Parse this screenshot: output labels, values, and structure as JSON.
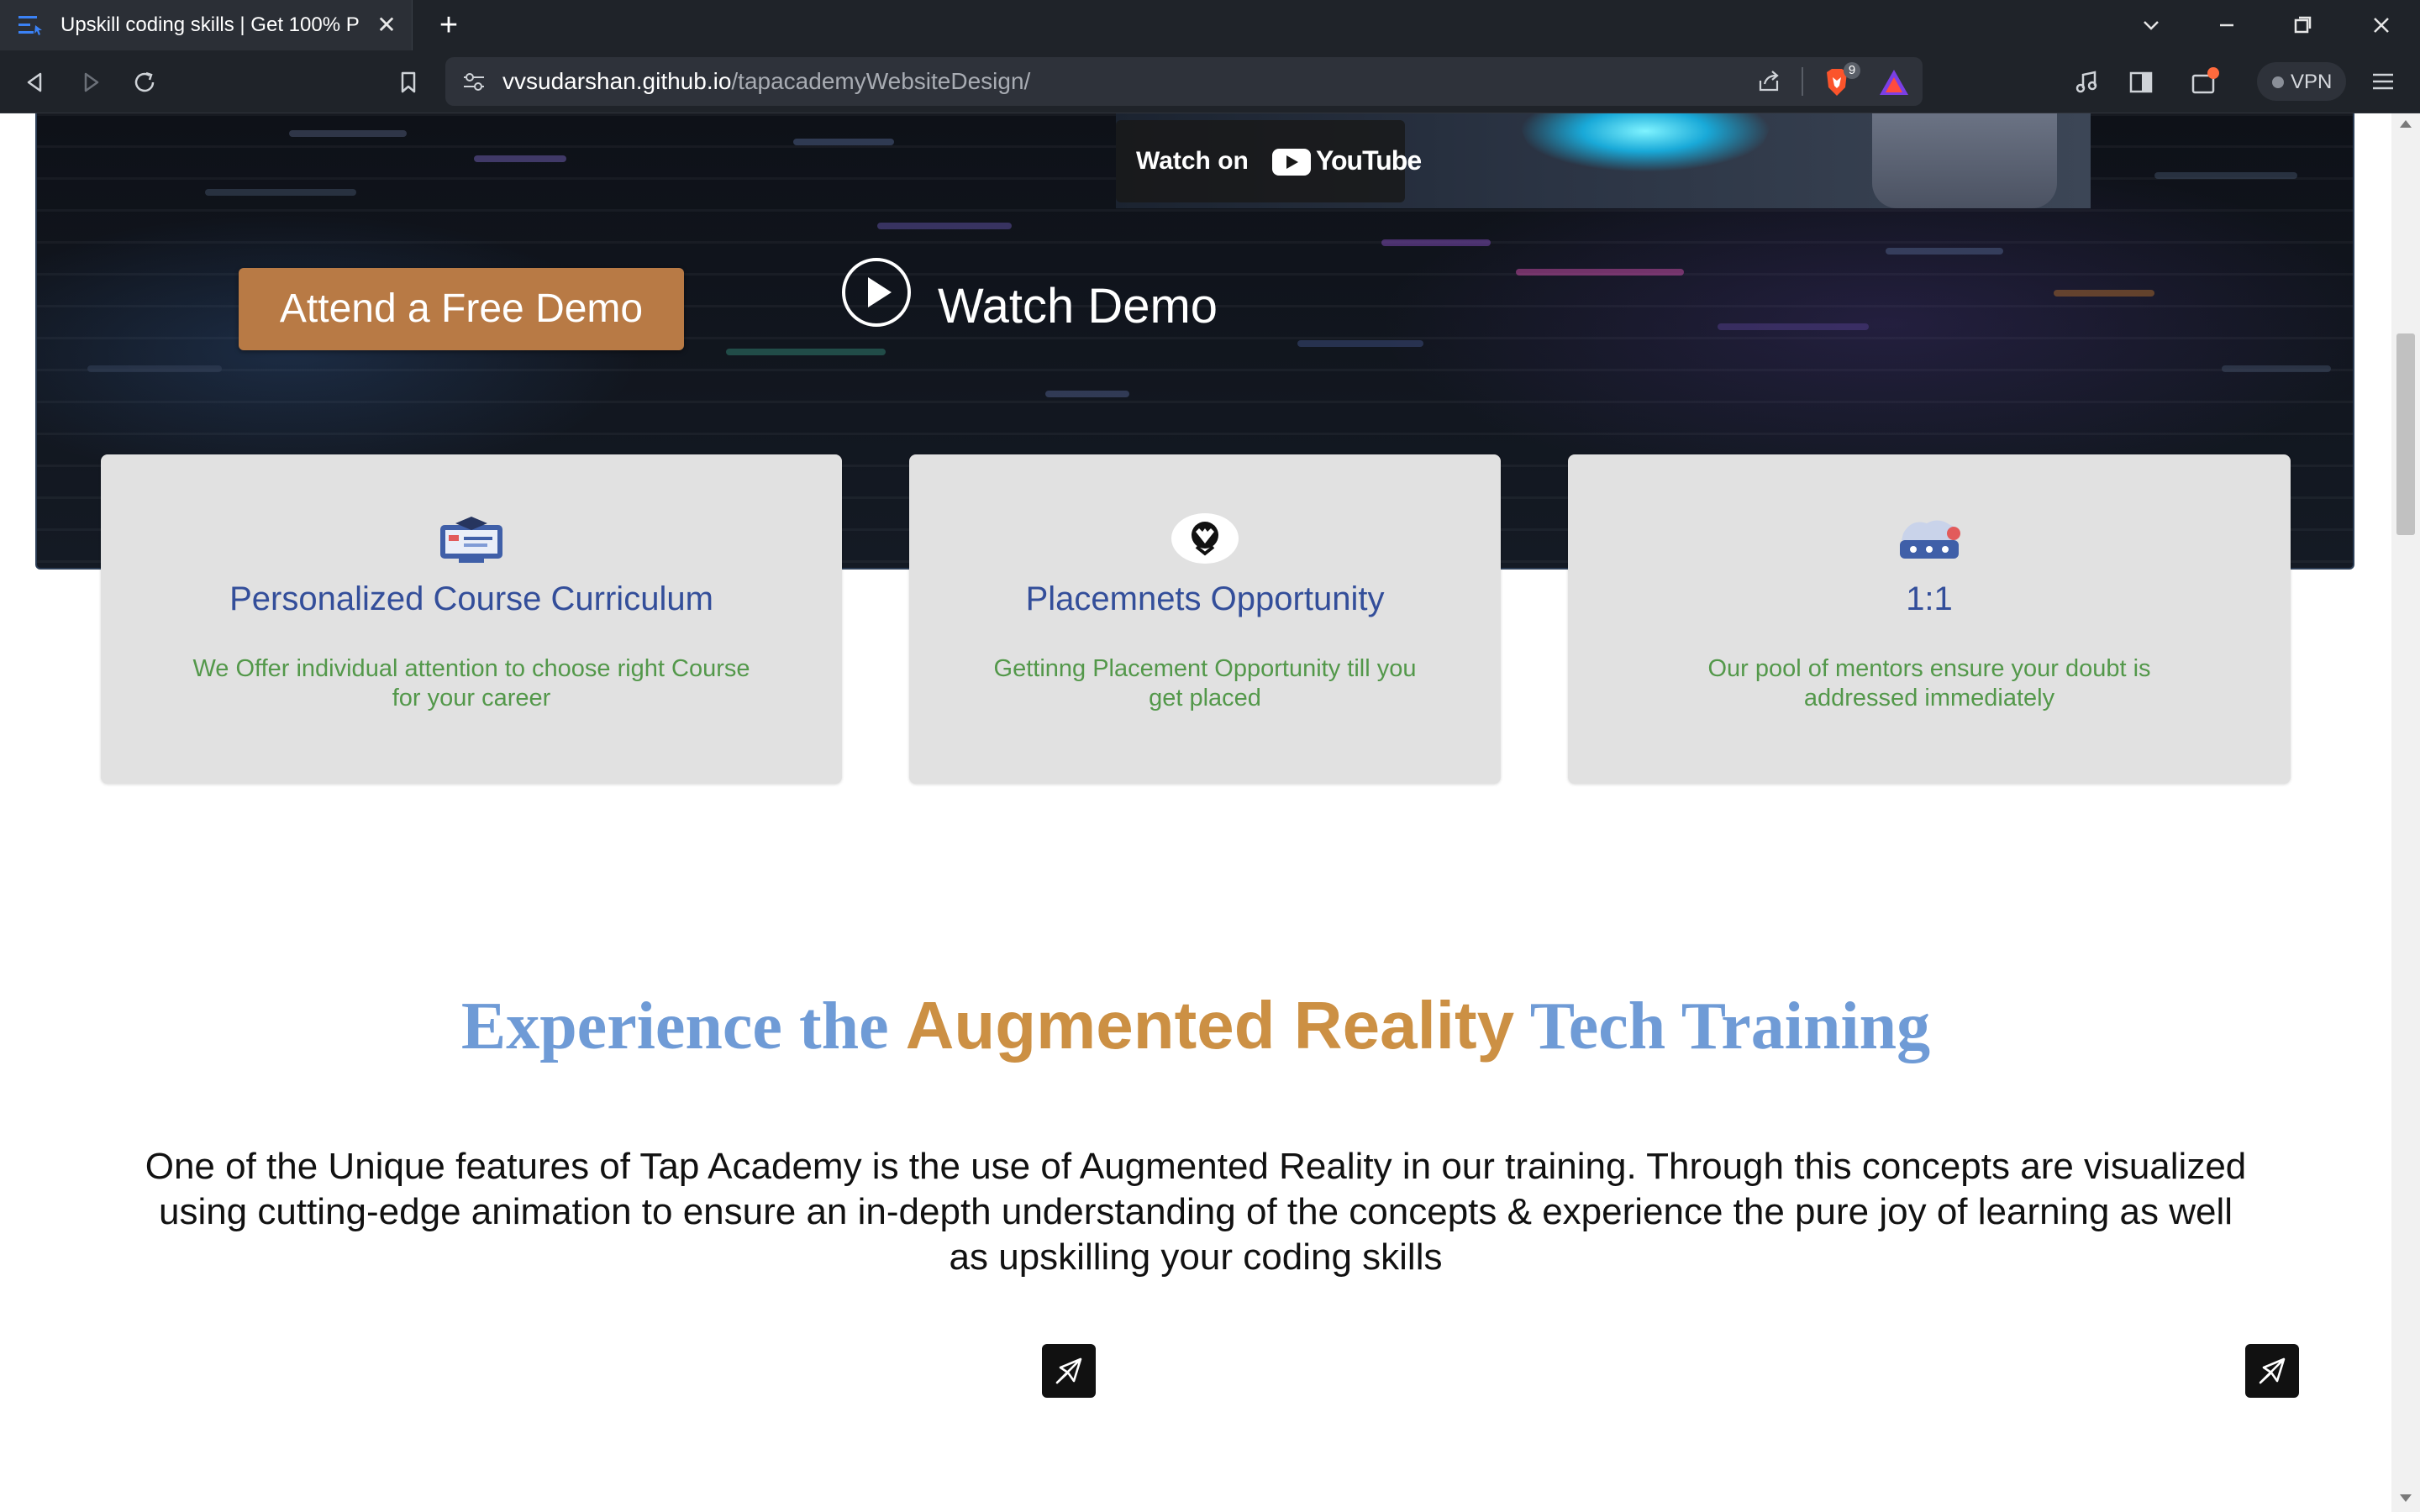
{
  "browser": {
    "tab_title": "Upskill coding skills | Get 100% P",
    "close_glyph": "✕",
    "new_tab_glyph": "+",
    "url_domain": "vvsudarshan.github.io",
    "url_path": "/tapacademyWebsiteDesign/",
    "shields_count": "9",
    "vpn_label": "VPN"
  },
  "hero": {
    "youtube_watch_label": "Watch on",
    "youtube_logo_text": "YouTube",
    "demo_button_label": "Attend a Free Demo",
    "watch_demo_label": "Watch Demo"
  },
  "features": [
    {
      "icon": "graduation-screen-icon",
      "title": "Personalized Course Curriculum",
      "description": "We Offer individual attention to choose right Course for your career"
    },
    {
      "icon": "placement-badge-icon",
      "title": "Placemnets Opportunity",
      "description": "Gettinng Placement Opportunity till you get placed"
    },
    {
      "icon": "mentor-chat-icon",
      "title": "1:1",
      "description": "Our pool of mentors ensure your doubt is addressed immediately"
    }
  ],
  "ar_section": {
    "heading_part1": "Experience the ",
    "heading_highlight": "Augmented Reality",
    "heading_part2": " Tech Training",
    "paragraph": "One of the Unique features of Tap Academy is the use of Augmented Reality in our training. Through this concepts are visualized using cutting-edge animation to ensure an in-depth understanding of the concepts & experience the pure joy of learning as well as upskilling your coding skills"
  },
  "colors": {
    "demo_button": "#b87a45",
    "card_title": "#334e9a",
    "card_desc": "#53984a",
    "heading_blue": "#6f9bd6",
    "heading_gold": "#cc9044"
  }
}
